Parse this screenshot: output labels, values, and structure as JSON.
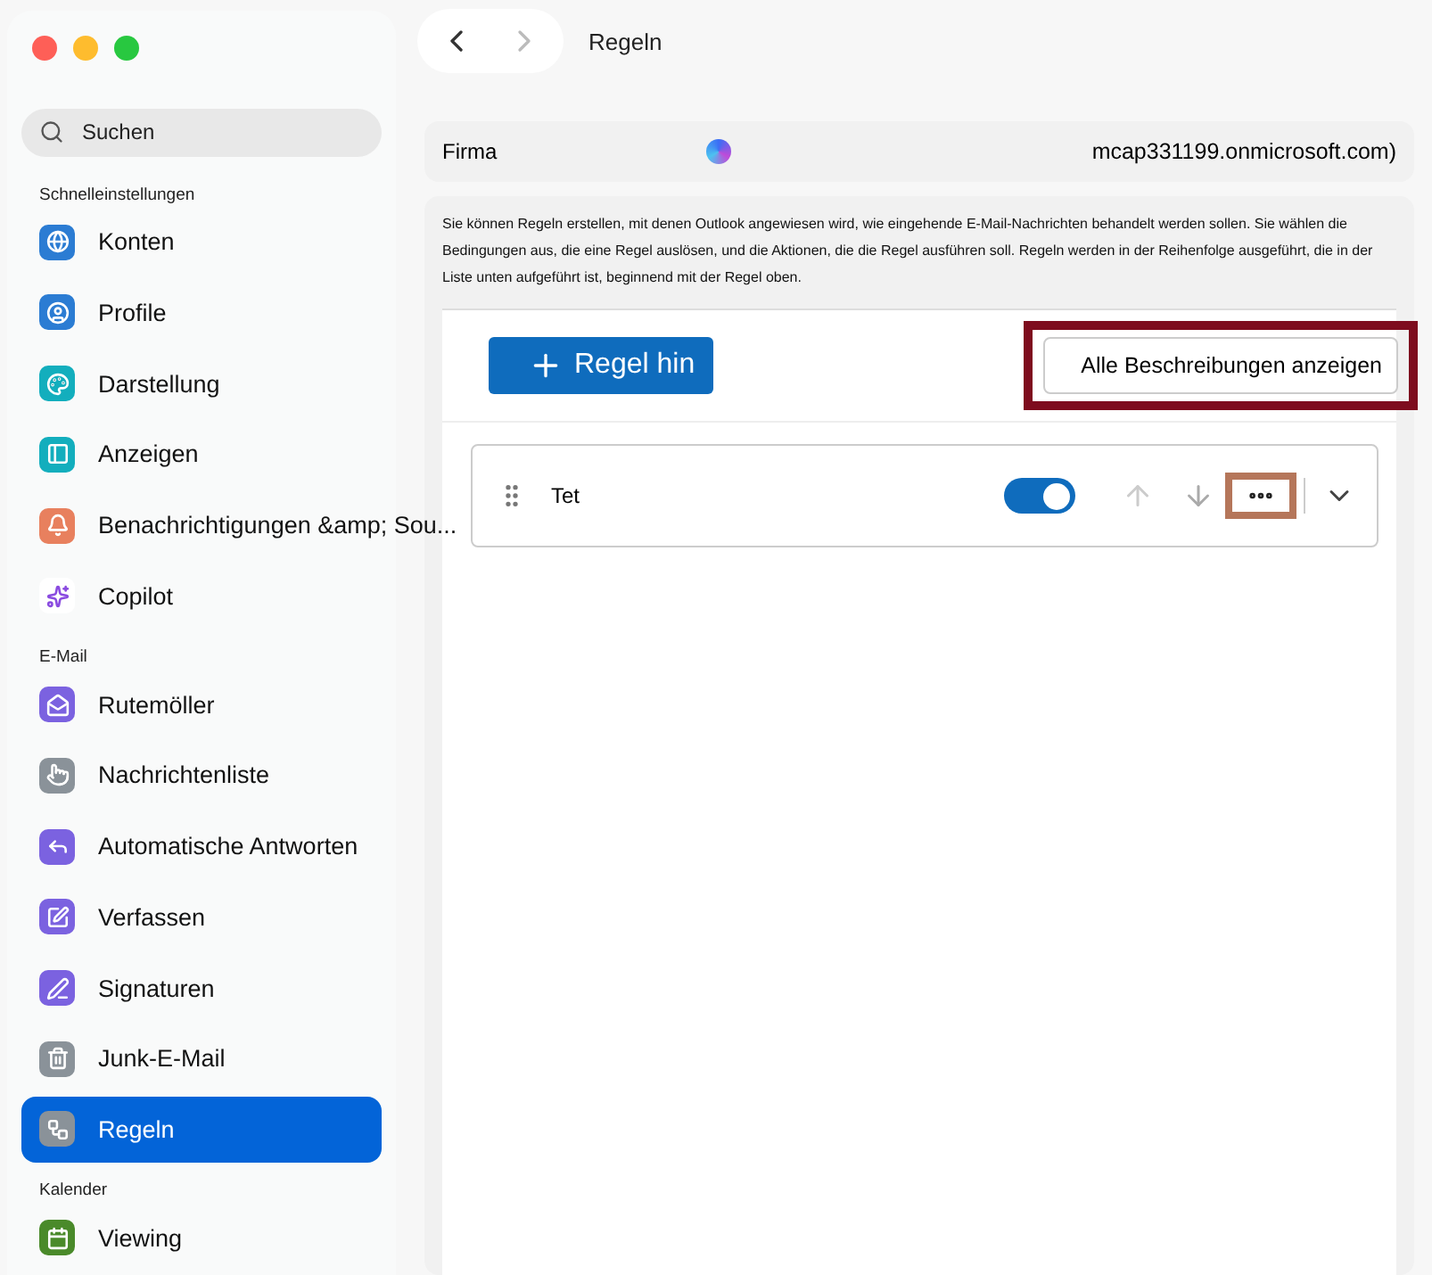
{
  "window": {
    "title": "Regeln"
  },
  "search": {
    "placeholder": "Suchen"
  },
  "sidebar": {
    "sections": [
      {
        "title": "Schnelleinstellungen",
        "items": [
          {
            "label": "Konten",
            "color": "#2b7cd3",
            "selected": false
          },
          {
            "label": "Profile",
            "color": "#2b7cd3",
            "selected": false
          },
          {
            "label": "Darstellung",
            "color": "#13aebd",
            "selected": false
          },
          {
            "label": "Anzeigen",
            "color": "#13aebd",
            "selected": false
          },
          {
            "label": "Benachrichtigungen &amp; Sou...",
            "color": "#e8805e",
            "selected": false
          },
          {
            "label": "Copilot",
            "color": "#ffffff",
            "selected": false
          }
        ]
      },
      {
        "title": "E-Mail",
        "items": [
          {
            "label": "Rutemöller",
            "color": "#7b62e0",
            "selected": false
          },
          {
            "label": "Nachrichtenliste",
            "color": "#8a9299",
            "selected": false
          },
          {
            "label": "Automatische Antworten",
            "color": "#7b62e0",
            "selected": false
          },
          {
            "label": "Verfassen",
            "color": "#7b62e0",
            "selected": false
          },
          {
            "label": "Signaturen",
            "color": "#7b62e0",
            "selected": false
          },
          {
            "label": "Junk-E-Mail",
            "color": "#8a9299",
            "selected": false
          },
          {
            "label": "Regeln",
            "color": "#8a9299",
            "selected": true
          }
        ]
      },
      {
        "title": "Kalender",
        "items": [
          {
            "label": "Viewing",
            "color": "#4a8a2a",
            "selected": false
          }
        ]
      }
    ]
  },
  "account": {
    "label": "Firma",
    "value": "mcap331199.onmicrosoft.com)"
  },
  "description": "Sie können Regeln erstellen, mit denen Outlook angewiesen wird, wie eingehende E-Mail-Nachrichten behandelt werden sollen. Sie wählen die Bedingungen aus, die eine Regel auslösen, und die Aktionen, die die Regel ausführen soll. Regeln werden in der Reihenfolge ausgeführt, die in der Liste unten aufgeführt ist, beginnend mit der Regel oben.",
  "add_button": {
    "label": "Regel hin"
  },
  "show_all_button": {
    "label": "Alle Beschreibungen anzeigen",
    "highlighted": true
  },
  "rules": [
    {
      "name": "Tet",
      "on": true,
      "more_highlighted": true
    }
  ]
}
